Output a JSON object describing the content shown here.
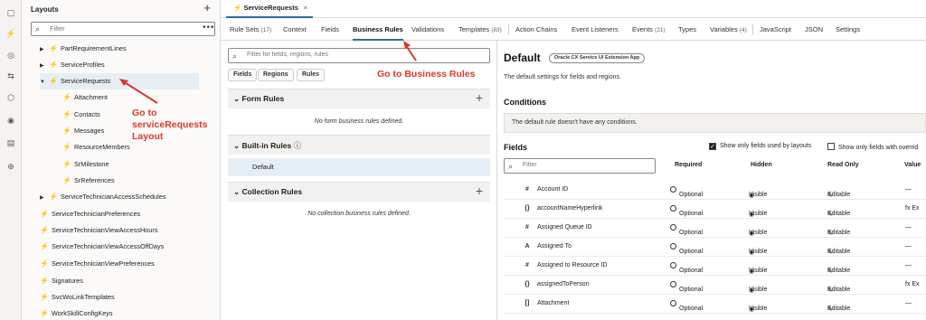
{
  "left_panel": {
    "title": "Layouts",
    "filter_placeholder": "Filter",
    "items": [
      {
        "label": "PartRequirementLines"
      },
      {
        "label": "ServiceProfiles"
      },
      {
        "label": "ServiceRequests"
      },
      {
        "label": "Attachment"
      },
      {
        "label": "Contacts"
      },
      {
        "label": "Messages"
      },
      {
        "label": "ResourceMembers"
      },
      {
        "label": "SrMilestone"
      },
      {
        "label": "SrReferences"
      },
      {
        "label": "ServiceTechnicianAccessSchedules"
      },
      {
        "label": "ServiceTechnicianPreferences"
      },
      {
        "label": "ServiceTechnicianViewAccessHours"
      },
      {
        "label": "ServiceTechnicianViewAccessOffDays"
      },
      {
        "label": "ServiceTechnicianViewPreferences"
      },
      {
        "label": "Signatures"
      },
      {
        "label": "SvcWoLinkTemplates"
      },
      {
        "label": "WorkSkillConfigKeys"
      }
    ]
  },
  "annotations": {
    "left": "Go to\nserviceRequests\nLayout",
    "middle": "Go to Business Rules"
  },
  "file_tab": {
    "label": "ServiceRequests"
  },
  "tabs": [
    {
      "label": "Rule Sets",
      "count": "(17)"
    },
    {
      "label": "Context",
      "count": ""
    },
    {
      "label": "Fields",
      "count": ""
    },
    {
      "label": "Business Rules",
      "count": ""
    },
    {
      "label": "Validations",
      "count": ""
    },
    {
      "label": "Templates",
      "count": "(83)"
    },
    {
      "label": "Action Chains",
      "count": ""
    },
    {
      "label": "Event Listeners",
      "count": ""
    },
    {
      "label": "Events",
      "count": "(21)"
    },
    {
      "label": "Types",
      "count": ""
    },
    {
      "label": "Variables",
      "count": "(4)"
    },
    {
      "label": "JavaScript",
      "count": ""
    },
    {
      "label": "JSON",
      "count": ""
    },
    {
      "label": "Settings",
      "count": ""
    }
  ],
  "rules_panel": {
    "filter_placeholder": "Filter for fields, regions, rules",
    "chips": [
      "Fields",
      "Regions",
      "Rules"
    ],
    "form_rules": {
      "title": "Form Rules",
      "empty": "No form business rules defined."
    },
    "builtin_rules": {
      "title": "Built-in Rules",
      "item": "Default"
    },
    "collection_rules": {
      "title": "Collection Rules",
      "empty": "No collection business rules defined."
    }
  },
  "detail": {
    "title": "Default",
    "badge": "Oracle CX Service UI Extension App",
    "description": "The default settings for fields and regions.",
    "conditions_title": "Conditions",
    "conditions_text": "The default rule doesn't have any conditions.",
    "fields_title": "Fields",
    "cb_used": "Show only fields used by layouts",
    "cb_override": "Show only fields with overrid",
    "filter_placeholder": "Filter",
    "columns": [
      "Required",
      "Hidden",
      "Read Only",
      "Value"
    ],
    "rows": [
      {
        "type": "#",
        "name": "Account ID",
        "required": "Optional",
        "hidden": "Visible",
        "readonly": "Editable",
        "value": "—"
      },
      {
        "type": "{}",
        "name": "accountNameHyperlink",
        "required": "Optional",
        "hidden": "Visible",
        "readonly": "Editable",
        "value": "fx Ex"
      },
      {
        "type": "#",
        "name": "Assigned Queue ID",
        "required": "Optional",
        "hidden": "Visible",
        "readonly": "Editable",
        "value": "—"
      },
      {
        "type": "A",
        "name": "Assigned To",
        "required": "Optional",
        "hidden": "Visible",
        "readonly": "Editable",
        "value": "—"
      },
      {
        "type": "#",
        "name": "Assigned to Resource ID",
        "required": "Optional",
        "hidden": "Visible",
        "readonly": "Editable",
        "value": "—"
      },
      {
        "type": "{}",
        "name": "assignedToPerson",
        "required": "Optional",
        "hidden": "Visible",
        "readonly": "Editable",
        "value": "fx Ex"
      },
      {
        "type": "[]",
        "name": "Attachment",
        "required": "Optional",
        "hidden": "Visible",
        "readonly": "Editable",
        "value": "—"
      }
    ]
  },
  "colors": {
    "accent": "#2a6f98",
    "annotation": "#d93a2b",
    "selection": "#e6eef5"
  }
}
